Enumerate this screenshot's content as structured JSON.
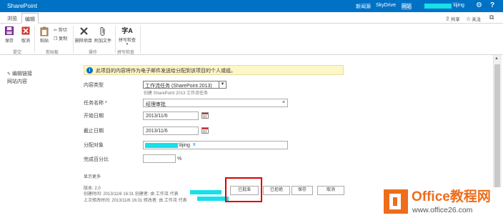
{
  "suite_bar": {
    "brand": "SharePoint",
    "links": [
      "新闻源",
      "SkyDrive",
      "网站"
    ],
    "user_suffix": "\\lijing",
    "icons": [
      "gear-icon",
      "help-icon"
    ]
  },
  "ribbon_tabs": {
    "tabs": [
      "浏览",
      "编辑"
    ],
    "active": "编辑",
    "share_label": "共享",
    "follow_label": "关注",
    "focus_icon": "focus-on-content-icon"
  },
  "ribbon": {
    "commit": {
      "save": "保存",
      "cancel": "取消",
      "label": "提交"
    },
    "clipboard": {
      "paste": "粘贴",
      "cut": "剪切",
      "copy": "复制",
      "label": "剪贴板"
    },
    "actions": {
      "delete_item": "删除项目",
      "attach_file": "附加文件",
      "label": "操作"
    },
    "spelling": {
      "check": "拼写检查",
      "label": "拼写检查",
      "glyph": "字A"
    }
  },
  "left_nav": {
    "edit_links": "编辑链接",
    "site_contents": "网站内容"
  },
  "form": {
    "notice": "此项目的内容将作为电子邮件发送给分配到该项目的个人或组。",
    "content_type_label": "内容类型",
    "content_type_value": "工作流任务 (SharePoint 2013)",
    "content_type_hint": "创建 SharePoint 2013 工作流任务",
    "task_name_label": "任务名称",
    "required_marker": "*",
    "task_name_value": "经理审批",
    "clear_glyph": "×",
    "start_date_label": "开始日期",
    "start_date_value": "2013/11/6",
    "due_date_label": "截止日期",
    "due_date_value": "2013/11/6",
    "assigned_label": "分配对象",
    "assigned_suffix": "\\lijing",
    "assigned_remove": "x",
    "percent_label": "完成百分比",
    "percent_value": "",
    "percent_unit": "%",
    "show_more": "显示更多",
    "version": "版本: 2.0",
    "created": "创建时间: 2013/11/6 16:31  创建者: 由 工作流 代表",
    "modified": "上次修改时间: 2013/11/6 16:31  修改者: 由 工作流 代表"
  },
  "buttons": {
    "approved": "已批准",
    "rejected": "已拒绝",
    "save": "保存",
    "cancel": "取消"
  },
  "watermark": {
    "title": "Office教程网",
    "url": "www.office26.com"
  },
  "colors": {
    "suite_bar": "#0072c6",
    "notice_bg": "#fdf6c7",
    "highlight": "#dd0000",
    "redaction": "#16e0ea",
    "watermark_orange": "#ef6c1a"
  }
}
